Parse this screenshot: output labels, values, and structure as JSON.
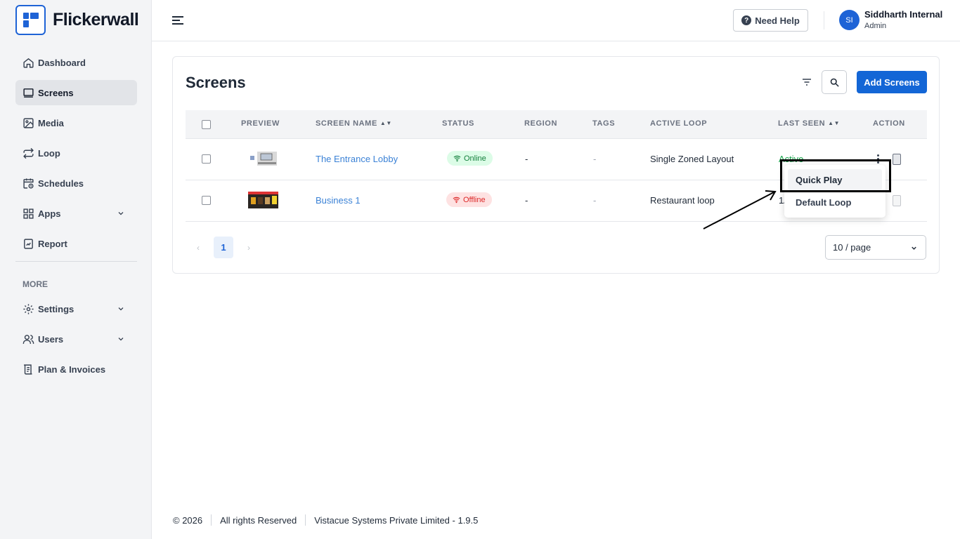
{
  "app": {
    "name": "Flickerwall"
  },
  "sidebar": {
    "items": [
      {
        "label": "Dashboard"
      },
      {
        "label": "Screens"
      },
      {
        "label": "Media"
      },
      {
        "label": "Loop"
      },
      {
        "label": "Schedules"
      },
      {
        "label": "Apps"
      },
      {
        "label": "Report"
      }
    ],
    "more_label": "MORE",
    "more_items": [
      {
        "label": "Settings"
      },
      {
        "label": "Users"
      },
      {
        "label": "Plan & Invoices"
      }
    ]
  },
  "header": {
    "help_label": "Need Help",
    "help_icon": "?",
    "user": {
      "initials": "SI",
      "name": "Siddharth Internal",
      "role": "Admin"
    }
  },
  "page": {
    "title": "Screens",
    "add_label": "Add Screens"
  },
  "table": {
    "columns": [
      "PREVIEW",
      "SCREEN NAME",
      "STATUS",
      "REGION",
      "TAGS",
      "ACTIVE LOOP",
      "LAST SEEN",
      "ACTION"
    ],
    "rows": [
      {
        "name": "The Entrance Lobby",
        "status": "Online",
        "region": "-",
        "tags": "-",
        "active_loop": "Single Zoned Layout",
        "last_seen": "Active"
      },
      {
        "name": "Business 1",
        "status": "Offline",
        "region": "-",
        "tags": "-",
        "active_loop": "Restaurant loop",
        "last_seen": "1/"
      }
    ]
  },
  "pagination": {
    "prev": "‹",
    "current": "1",
    "next": "›",
    "page_size": "10 / page"
  },
  "action_menu": {
    "items": [
      "Quick Play",
      "Default Loop"
    ]
  },
  "footer": {
    "copyright": "© 2026",
    "rights": "All rights Reserved",
    "company": "Vistacue Systems Private Limited - 1.9.5"
  },
  "colors": {
    "brand": "#1e63d6",
    "online": "#15803d",
    "offline": "#dc2626"
  }
}
